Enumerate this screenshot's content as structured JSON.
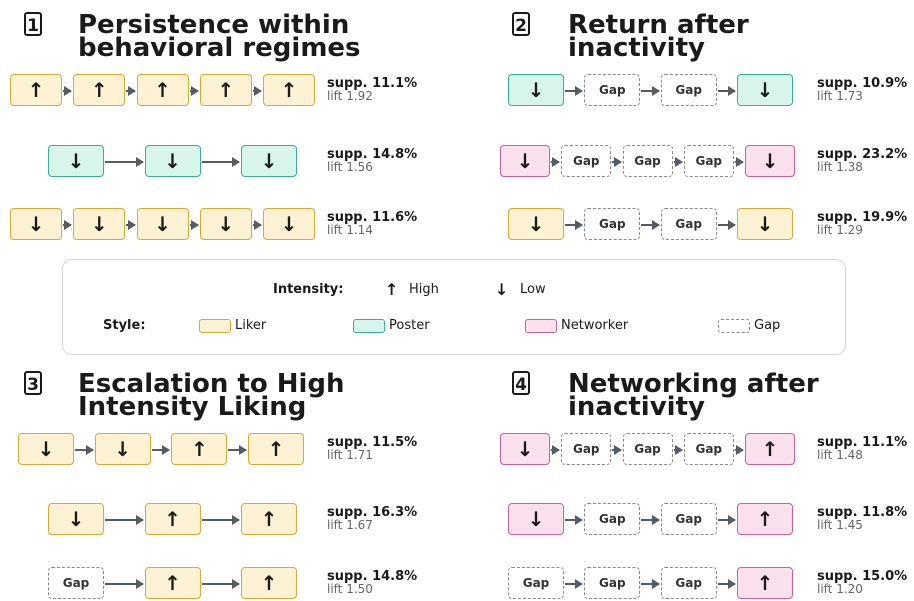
{
  "panels": [
    {
      "number": "1",
      "title": "Persistence within\nbehavioral regimes",
      "rows": [
        {
          "nodes": [
            [
              "liker",
              "↑"
            ],
            [
              "liker",
              "↑"
            ],
            [
              "liker",
              "↑"
            ],
            [
              "liker",
              "↑"
            ],
            [
              "liker",
              "↑"
            ]
          ],
          "supp": "supp. 11.1%",
          "lift": "lift  1.92"
        },
        {
          "nodes": [
            [
              "poster",
              "↓"
            ],
            [
              "poster",
              "↓"
            ],
            [
              "poster",
              "↓"
            ]
          ],
          "supp": "supp. 14.8%",
          "lift": "lift  1.56"
        },
        {
          "nodes": [
            [
              "liker",
              "↓"
            ],
            [
              "liker",
              "↓"
            ],
            [
              "liker",
              "↓"
            ],
            [
              "liker",
              "↓"
            ],
            [
              "liker",
              "↓"
            ]
          ],
          "supp": "supp. 11.6%",
          "lift": "lift  1.14"
        }
      ]
    },
    {
      "number": "2",
      "title": "Return after\ninactivity",
      "rows": [
        {
          "nodes": [
            [
              "poster",
              "↓"
            ],
            [
              "gap",
              "Gap"
            ],
            [
              "gap",
              "Gap"
            ],
            [
              "poster",
              "↓"
            ]
          ],
          "supp": "supp. 10.9%",
          "lift": "lift  1.73"
        },
        {
          "nodes": [
            [
              "networker",
              "↓"
            ],
            [
              "gap",
              "Gap"
            ],
            [
              "gap",
              "Gap"
            ],
            [
              "gap",
              "Gap"
            ],
            [
              "networker",
              "↓"
            ]
          ],
          "supp": "supp. 23.2%",
          "lift": "lift  1.38"
        },
        {
          "nodes": [
            [
              "liker",
              "↓"
            ],
            [
              "gap",
              "Gap"
            ],
            [
              "gap",
              "Gap"
            ],
            [
              "liker",
              "↓"
            ]
          ],
          "supp": "supp. 19.9%",
          "lift": "lift  1.29"
        }
      ]
    },
    {
      "number": "3",
      "title": "Escalation to High\nIntensity Liking",
      "rows": [
        {
          "nodes": [
            [
              "liker",
              "↓"
            ],
            [
              "liker",
              "↓"
            ],
            [
              "liker",
              "↑"
            ],
            [
              "liker",
              "↑"
            ]
          ],
          "supp": "supp. 11.5%",
          "lift": "lift  1.71"
        },
        {
          "nodes": [
            [
              "liker",
              "↓"
            ],
            [
              "liker",
              "↑"
            ],
            [
              "liker",
              "↑"
            ]
          ],
          "supp": "supp. 16.3%",
          "lift": "lift  1.67"
        },
        {
          "nodes": [
            [
              "gap",
              "Gap"
            ],
            [
              "liker",
              "↑"
            ],
            [
              "liker",
              "↑"
            ]
          ],
          "supp": "supp. 14.8%",
          "lift": "lift  1.50"
        }
      ]
    },
    {
      "number": "4",
      "title": "Networking after\ninactivity",
      "rows": [
        {
          "nodes": [
            [
              "networker",
              "↓"
            ],
            [
              "gap",
              "Gap"
            ],
            [
              "gap",
              "Gap"
            ],
            [
              "gap",
              "Gap"
            ],
            [
              "networker",
              "↑"
            ]
          ],
          "supp": "supp. 11.1%",
          "lift": "lift  1.48"
        },
        {
          "nodes": [
            [
              "networker",
              "↓"
            ],
            [
              "gap",
              "Gap"
            ],
            [
              "gap",
              "Gap"
            ],
            [
              "networker",
              "↑"
            ]
          ],
          "supp": "supp. 11.8%",
          "lift": "lift  1.45"
        },
        {
          "nodes": [
            [
              "gap",
              "Gap"
            ],
            [
              "gap",
              "Gap"
            ],
            [
              "gap",
              "Gap"
            ],
            [
              "networker",
              "↑"
            ]
          ],
          "supp": "supp. 15.0%",
          "lift": "lift  1.20"
        }
      ]
    }
  ],
  "legend": {
    "intensity_label": "Intensity:",
    "high_symbol": "↑",
    "high_label": "High",
    "low_symbol": "↓",
    "low_label": "Low",
    "style_label": "Style:",
    "liker_label": "Liker",
    "poster_label": "Poster",
    "networker_label": "Networker",
    "gap_label": "Gap"
  },
  "colors": {
    "liker_fill": "#fdf3d4",
    "liker_border": "#e0a82e",
    "poster_fill": "#d8f5ec",
    "poster_border": "#34b394",
    "networker_fill": "#fbe1ee",
    "networker_border": "#d35d96",
    "gap_border": "#8a8a8a",
    "connector": "#555b63"
  }
}
